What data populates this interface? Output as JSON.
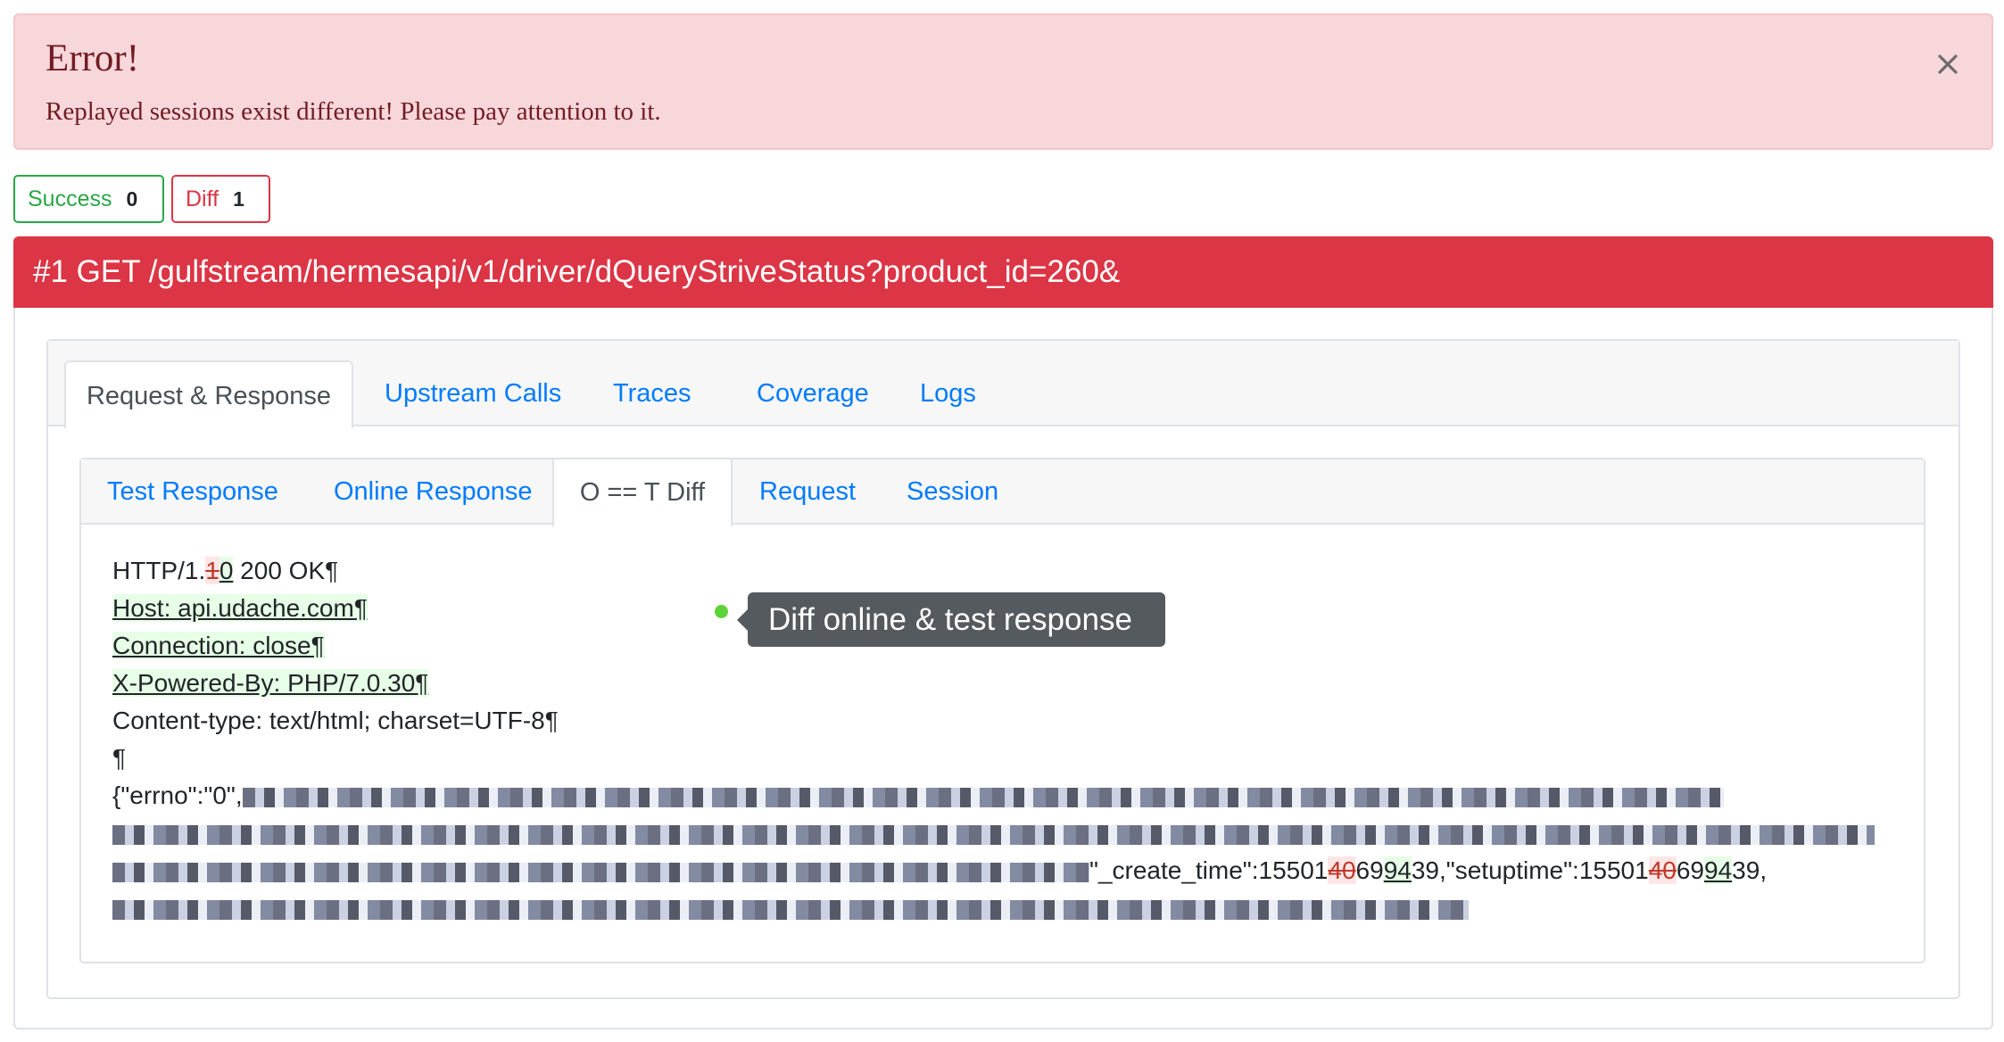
{
  "alert": {
    "title": "Error!",
    "message": "Replayed sessions exist different! Please pay attention to it.",
    "close_icon": "close-icon"
  },
  "badges": {
    "success_label": "Success",
    "success_count": "0",
    "diff_label": "Diff",
    "diff_count": "1"
  },
  "session": {
    "header": "#1 GET /gulfstream/hermesapi/v1/driver/dQueryStriveStatus?product_id=260&"
  },
  "outer_tabs": {
    "active": "Request & Response",
    "items": [
      "Upstream Calls",
      "Traces",
      "Coverage",
      "Logs"
    ]
  },
  "inner_tabs": {
    "active": "O == T Diff",
    "items": [
      "Test Response",
      "Online Response",
      "Request",
      "Session"
    ]
  },
  "diff": {
    "line1_a": "HTTP/1.",
    "line1_del": "1",
    "line1_ins": "0",
    "line1_b": " 200 OK¶",
    "line2": "Host: api.udache.com¶",
    "line3": "Connection: close¶",
    "line4": "X-Powered-By: PHP/7.0.30¶",
    "line5": "Content-type: text/html; charset=UTF-8¶",
    "line6": "¶",
    "line7": "{\"errno\":\"0\",",
    "line9_a": "\"_create_time\":15501",
    "line9_del1": "40",
    "line9_mid1": "69",
    "line9_ins1": "94",
    "line9_b": "39,\"setuptime\":15501",
    "line9_del2": "40",
    "line9_mid2": "69",
    "line9_ins2": "94",
    "line9_c": "39,"
  },
  "tooltip": {
    "text": "Diff online & test response"
  },
  "colors": {
    "danger": "#dc3545",
    "success": "#28a745",
    "link": "#007bff",
    "tooltip_dot": "#5cd33a"
  }
}
